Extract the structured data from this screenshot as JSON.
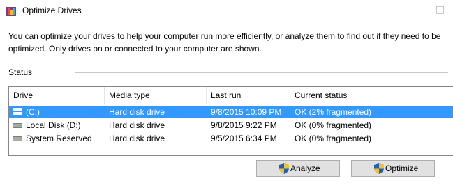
{
  "window": {
    "title": "Optimize Drives"
  },
  "description": "You can optimize your drives to help your computer run more efficiently, or analyze them to find out if they need to be optimized. Only drives on or connected to your computer are shown.",
  "status_section": {
    "label": "Status"
  },
  "table": {
    "columns": [
      "Drive",
      "Media type",
      "Last run",
      "Current status"
    ],
    "rows": [
      {
        "drive": "(C:)",
        "media_type": "Hard disk drive",
        "last_run": "9/8/2015 10:09 PM",
        "current_status": "OK (2% fragmented)",
        "icon": "windows-drive-icon",
        "selected": true
      },
      {
        "drive": "Local Disk (D:)",
        "media_type": "Hard disk drive",
        "last_run": "9/8/2015 9:22 PM",
        "current_status": "OK (0% fragmented)",
        "icon": "hard-drive-icon",
        "selected": false
      },
      {
        "drive": "System Reserved",
        "media_type": "Hard disk drive",
        "last_run": "9/5/2015 6:34 PM",
        "current_status": "OK (0% fragmented)",
        "icon": "hard-drive-icon",
        "selected": false
      }
    ]
  },
  "buttons": {
    "analyze": "Analyze",
    "optimize": "Optimize"
  },
  "colors": {
    "selection": "#3399ff",
    "button_face": "#e1e1e1"
  }
}
